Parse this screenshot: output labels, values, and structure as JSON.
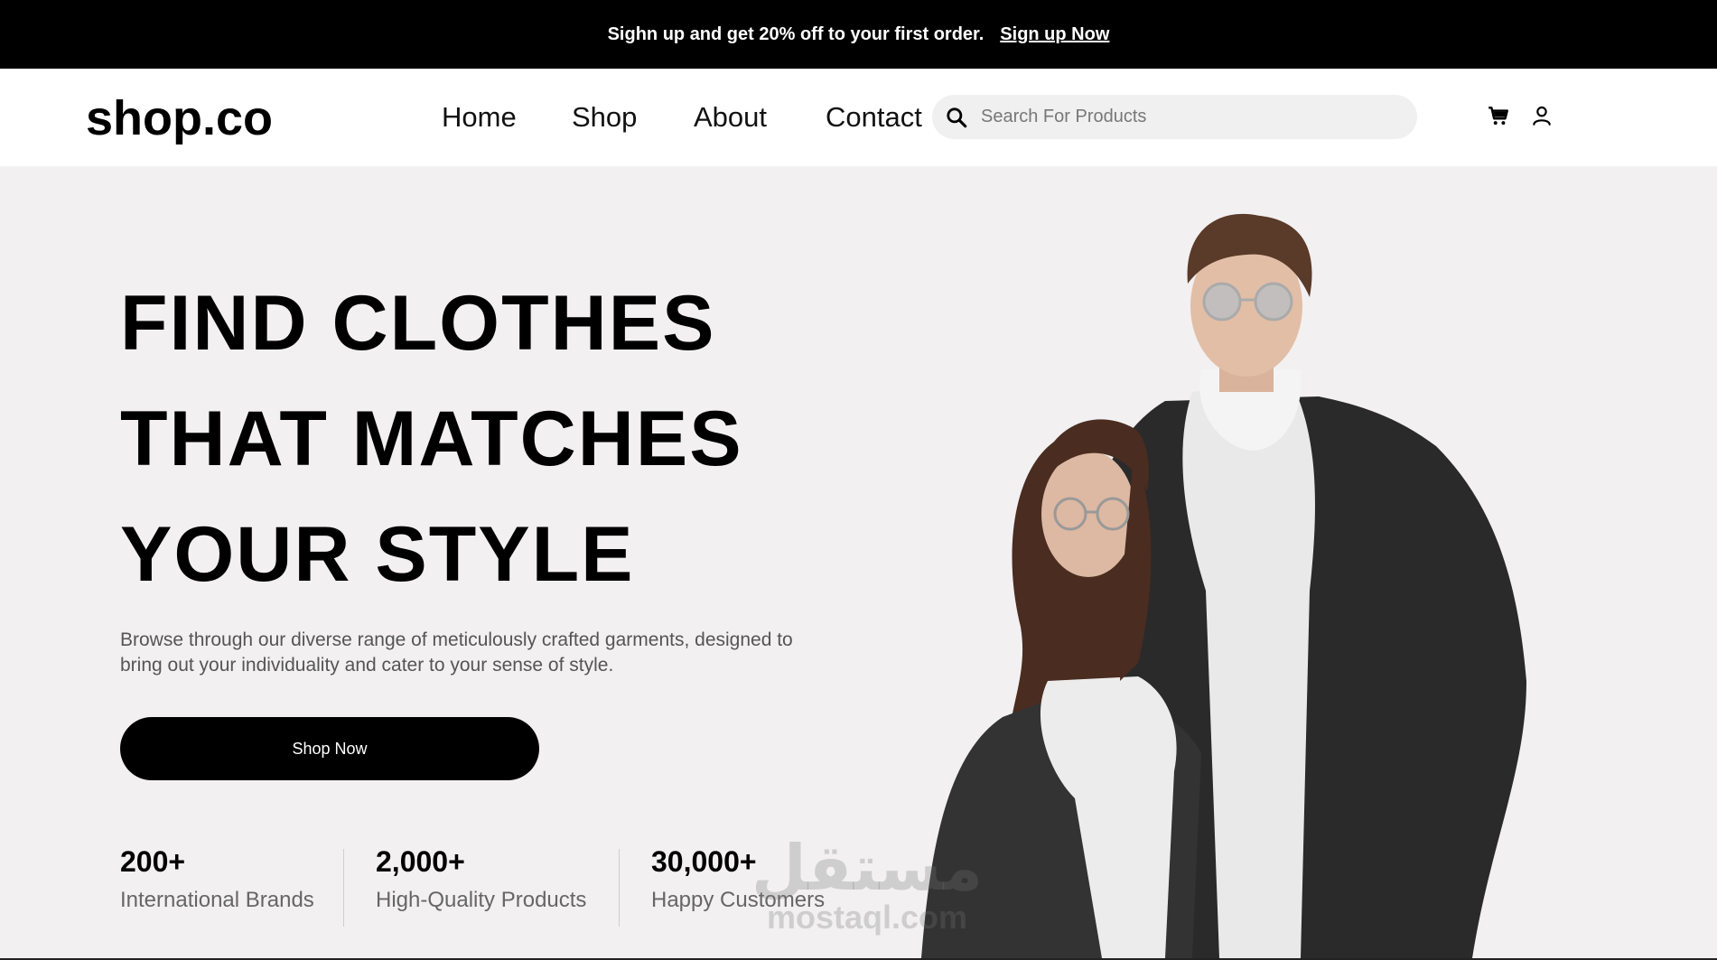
{
  "promo": {
    "text": "Sighn up and get 20% off to your first order.",
    "link": "Sign up Now"
  },
  "nav": {
    "logo": "shop.co",
    "links": [
      "Home",
      "Shop",
      "About",
      "Contact"
    ],
    "search_placeholder": "Search For Products",
    "icons": [
      "search-icon",
      "cart-icon",
      "account-icon"
    ]
  },
  "hero": {
    "title_lines": [
      "FIND CLOTHES",
      "THAT MATCHES",
      "YOUR STYLE"
    ],
    "description": "Browse through our diverse range of meticulously crafted garments, designed to bring out your individuality and cater to your sense of style.",
    "cta": "Shop Now",
    "stats": [
      {
        "value": "200+",
        "label": "International Brands"
      },
      {
        "value": "2,000+",
        "label": "High-Quality Products"
      },
      {
        "value": "30,000+",
        "label": "Happy Customers"
      }
    ]
  },
  "watermark": {
    "arabic": "مستقل",
    "latin": "mostaql.com"
  },
  "colors": {
    "promo_bg": "#000000",
    "hero_bg": "#f2f0f1",
    "button_bg": "#000000",
    "search_bg": "#f0f0f0"
  }
}
